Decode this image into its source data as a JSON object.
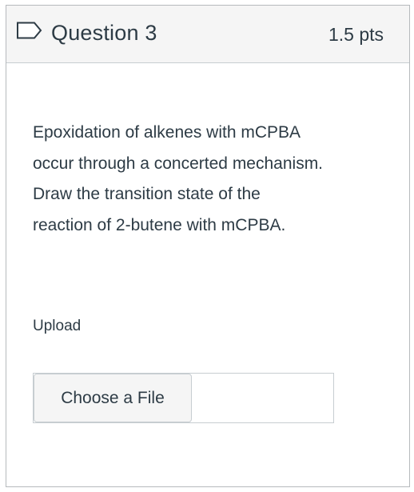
{
  "header": {
    "title": "Question 3",
    "points": "1.5 pts"
  },
  "question": {
    "lines": [
      "Epoxidation of alkenes with mCPBA",
      "occur through a concerted mechanism.",
      "Draw the transition state of the",
      "reaction of 2-butene with mCPBA."
    ]
  },
  "upload": {
    "label": "Upload",
    "button_label": "Choose a File",
    "file_name": ""
  },
  "icons": {
    "flag": "bookmark-flag-icon"
  },
  "colors": {
    "text": "#2d3b45",
    "header_bg": "#f5f5f5",
    "border": "#c7cdd1"
  }
}
